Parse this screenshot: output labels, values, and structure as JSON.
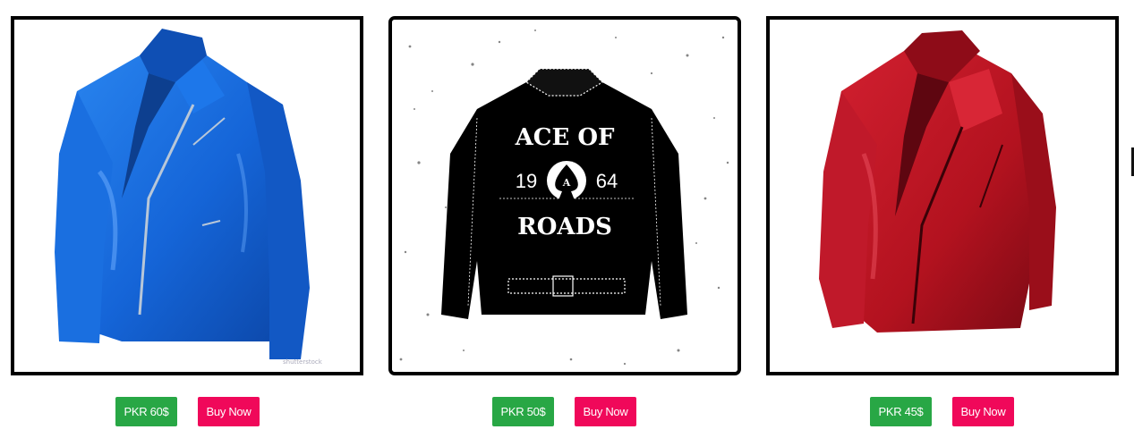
{
  "products": [
    {
      "image_alt": "Blue leather jacket",
      "image_icon": "blue-leather-jacket-image",
      "color": "#1565d8",
      "price_label": "PKR 60$",
      "buy_label": "Buy Now"
    },
    {
      "image_alt": "Black jacket with Ace of Roads print",
      "image_icon": "ace-of-roads-jacket-image",
      "color": "#000000",
      "print_top": "ACE OF",
      "print_left_year": "19",
      "print_right_year": "64",
      "print_bottom": "ROADS",
      "print_letter": "A",
      "price_label": "PKR 50$",
      "buy_label": "Buy Now"
    },
    {
      "image_alt": "Red leather jacket",
      "image_icon": "red-leather-jacket-image",
      "color": "#b3121f",
      "price_label": "PKR 45$",
      "buy_label": "Buy Now"
    }
  ],
  "colors": {
    "price_button": "#28a745",
    "buy_button": "#f0085a",
    "frame_border": "#000000"
  }
}
